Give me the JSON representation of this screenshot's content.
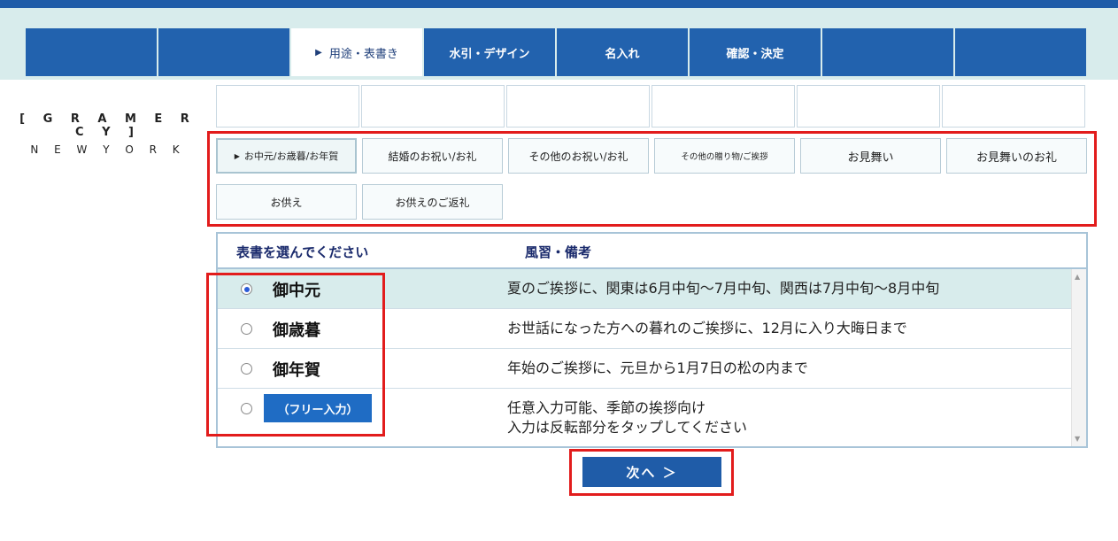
{
  "steps": [
    {
      "label": ""
    },
    {
      "label": ""
    },
    {
      "label": "用途・表書き",
      "active": true
    },
    {
      "label": "水引・デザイン"
    },
    {
      "label": "名入れ"
    },
    {
      "label": "確認・決定"
    },
    {
      "label": ""
    },
    {
      "label": ""
    }
  ],
  "logo": {
    "main": "[ G R A M E R C Y ]",
    "sub": "N E W Y O R K"
  },
  "categories": {
    "row1": [
      "お中元/お歳暮/お年賀",
      "結婚のお祝い/お礼",
      "その他のお祝い/お礼",
      "その他の贈り物/ご挨拶",
      "お見舞い",
      "お見舞いのお礼"
    ],
    "row2": [
      "お供え",
      "お供えのご返礼"
    ]
  },
  "table": {
    "header_omote": "表書を選んでください",
    "header_note": "風習・備考",
    "rows": [
      {
        "label": "御中元",
        "note": "夏のご挨拶に、関東は6月中旬～7月中旬、関西は7月中旬～8月中旬",
        "selected": true
      },
      {
        "label": "御歳暮",
        "note": "お世話になった方への暮れのご挨拶に、12月に入り大晦日まで"
      },
      {
        "label": "御年賀",
        "note": "年始のご挨拶に、元旦から1月7日の松の内まで"
      },
      {
        "label": "（フリー入力）",
        "note_line1": "任意入力可能、季節の挨拶向け",
        "note_line2": "入力は反転部分をタップしてください"
      }
    ]
  },
  "next_button": "次へ ＞",
  "colors": {
    "primary": "#1f5ca8",
    "highlight": "#e21c1c",
    "band": "#d8ecec"
  }
}
